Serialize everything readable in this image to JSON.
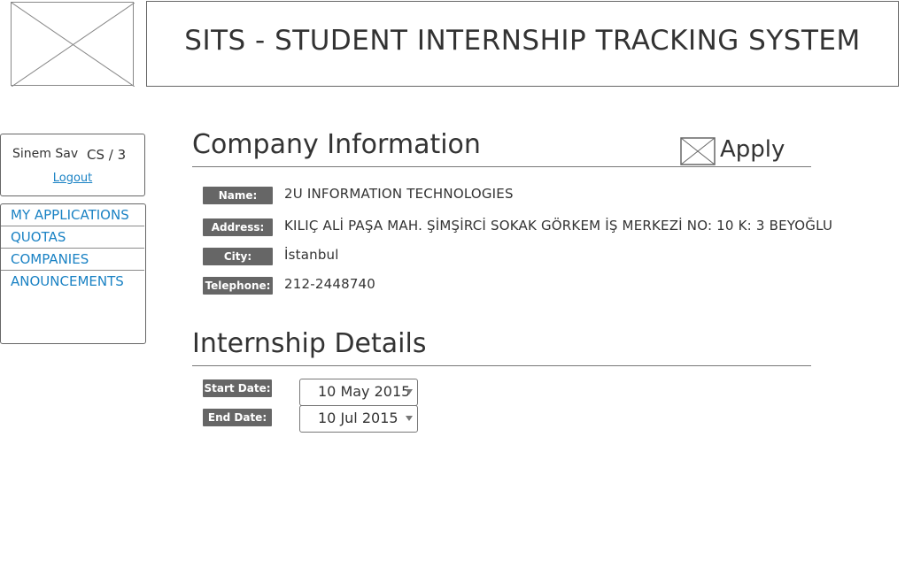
{
  "app": {
    "title": "SITS - STUDENT INTERNSHIP TRACKING SYSTEM",
    "logo_icon": "image-placeholder-icon"
  },
  "user": {
    "name": "Sinem Sav",
    "department": "CS / 3",
    "logout_label": "Logout"
  },
  "nav": {
    "items": [
      {
        "label": "MY APPLICATIONS"
      },
      {
        "label": "QUOTAS"
      },
      {
        "label": "COMPANIES"
      },
      {
        "label": "ANOUNCEMENTS"
      }
    ],
    "link_color": "#1a82c4"
  },
  "company": {
    "heading": "Company Information",
    "apply_label": "Apply",
    "apply_icon": "image-placeholder-icon",
    "fields": [
      {
        "label": "Name:",
        "value": "2U INFORMATION TECHNOLOGIES"
      },
      {
        "label": "Address:",
        "value": "KILIÇ ALİ PAŞA MAH. ŞİMŞİRCİ SOKAK GÖRKEM İŞ MERKEZİ NO: 10 K: 3 BEYOĞLU"
      },
      {
        "label": "City:",
        "value": "İstanbul"
      },
      {
        "label": "Telephone:",
        "value": "212-2448740"
      }
    ]
  },
  "internship": {
    "heading": "Internship Details",
    "start_label": "Start Date:",
    "start_value": "10 May 2015",
    "end_label": "End Date:",
    "end_value": "10 Jul 2015"
  }
}
